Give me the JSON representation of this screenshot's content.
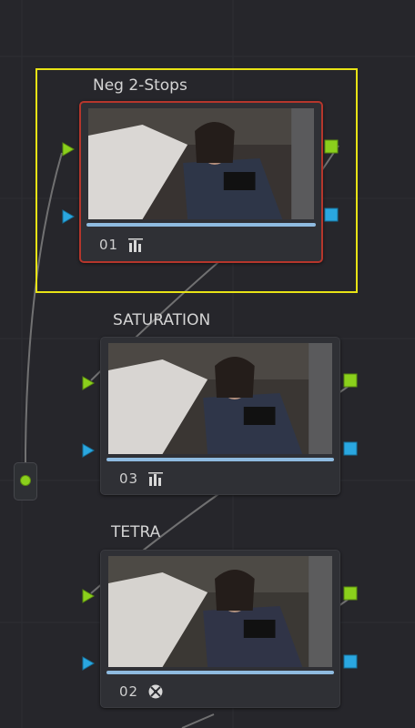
{
  "colors": {
    "background": "#26262b",
    "selection_box": "#e8e315",
    "selected_node_border": "#b5362c",
    "rgb_input_port": "#8bd01c",
    "key_input_port": "#2aa7e0",
    "rgb_output_port": "#8bd01c",
    "key_output_port": "#2aa7e0",
    "progress_bar": "#8fbbe0"
  },
  "source_node": {
    "icon": "source-dot-icon"
  },
  "nodes": [
    {
      "id": "n1",
      "title": "Neg 2-Stops",
      "number": "01",
      "tool_icon": "curves-bars-icon",
      "selected": true,
      "progress": 1.0
    },
    {
      "id": "n3",
      "title": "SATURATION",
      "number": "03",
      "tool_icon": "curves-bars-icon",
      "selected": false,
      "progress": 1.0
    },
    {
      "id": "n2",
      "title": "TETRA",
      "number": "02",
      "tool_icon": "color-wheel-icon",
      "selected": false,
      "progress": 1.0
    }
  ]
}
